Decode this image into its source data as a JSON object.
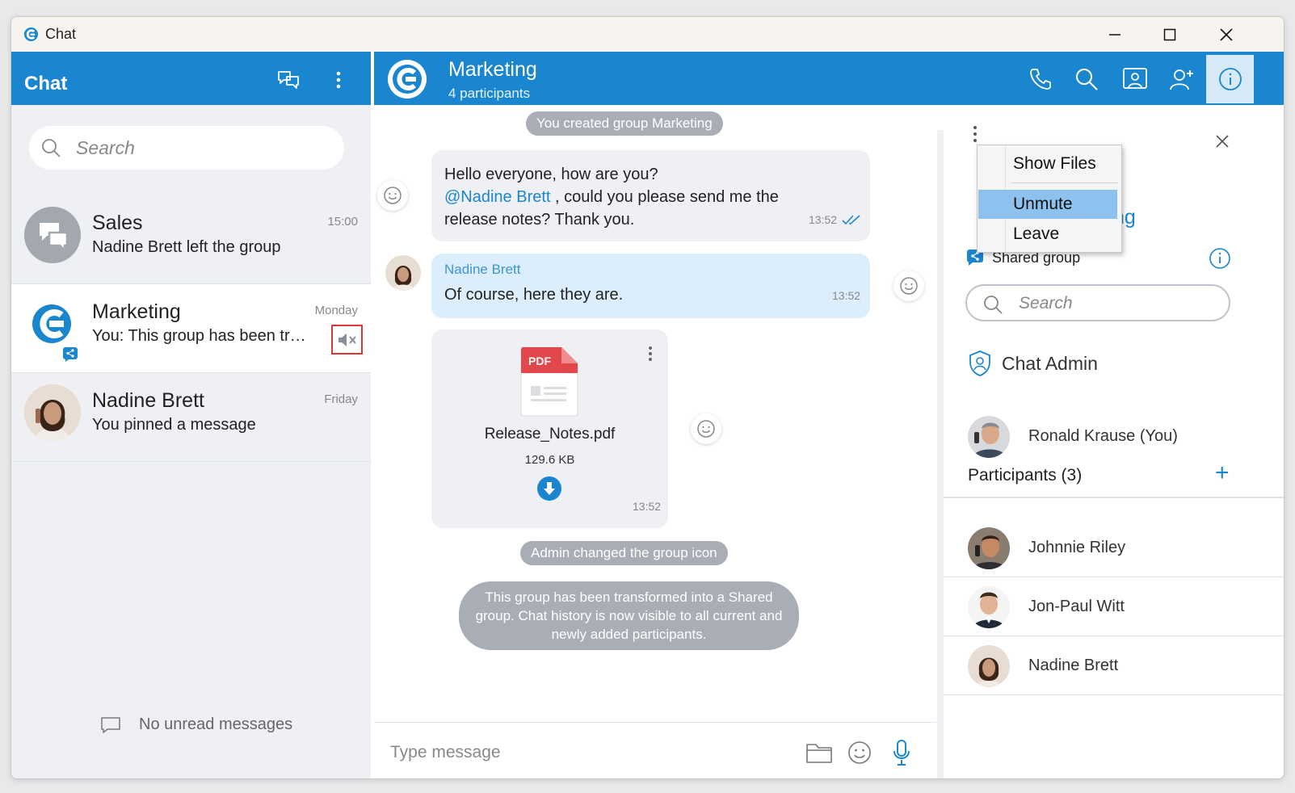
{
  "window": {
    "title": "Chat"
  },
  "left": {
    "title": "Chat",
    "search_placeholder": "Search",
    "conversations": [
      {
        "name": "Sales",
        "time": "15:00",
        "preview": "Nadine Brett left the group"
      },
      {
        "name": "Marketing",
        "time": "Monday",
        "preview": "You: This group has been tran..."
      },
      {
        "name": "Nadine Brett",
        "time": "Friday",
        "preview": "You pinned a message"
      }
    ],
    "unread": "No unread messages"
  },
  "chat": {
    "title": "Marketing",
    "subtitle": "4 participants",
    "system1": "You created group Marketing",
    "out_msg": {
      "line1": "Hello everyone, how are you?",
      "mention": "@Nadine Brett",
      "line2_rest": " , could you please send me the",
      "line3": "release notes? Thank you.",
      "time": "13:52"
    },
    "in_msg": {
      "sender": "Nadine Brett",
      "text": "Of course, here they are.",
      "time": "13:52"
    },
    "file": {
      "badge": "PDF",
      "name": "Release_Notes.pdf",
      "size": "129.6 KB",
      "time": "13:52"
    },
    "system2": "Admin changed the group icon",
    "system3_l1": "This group has been transformed into a Shared",
    "system3_l2": "group. Chat history is now visible to all current and",
    "system3_l3": "newly added participants.",
    "input_placeholder": "Type message"
  },
  "right": {
    "group_name_partial": "ng",
    "shared_label": "Shared group",
    "search_placeholder": "Search",
    "admin_label": "Chat Admin",
    "admin_person": "Ronald Krause (You)",
    "participants_title": "Participants (3)",
    "participants": [
      "Johnnie Riley",
      "Jon-Paul Witt",
      "Nadine Brett"
    ]
  },
  "menu": {
    "items": [
      "Show Files",
      "Unmute",
      "Leave"
    ],
    "selected": "Unmute"
  },
  "colors": {
    "brand": "#1a86cf",
    "mute_highlight": "#d9383a",
    "menu_selected": "#8ec2ee"
  }
}
